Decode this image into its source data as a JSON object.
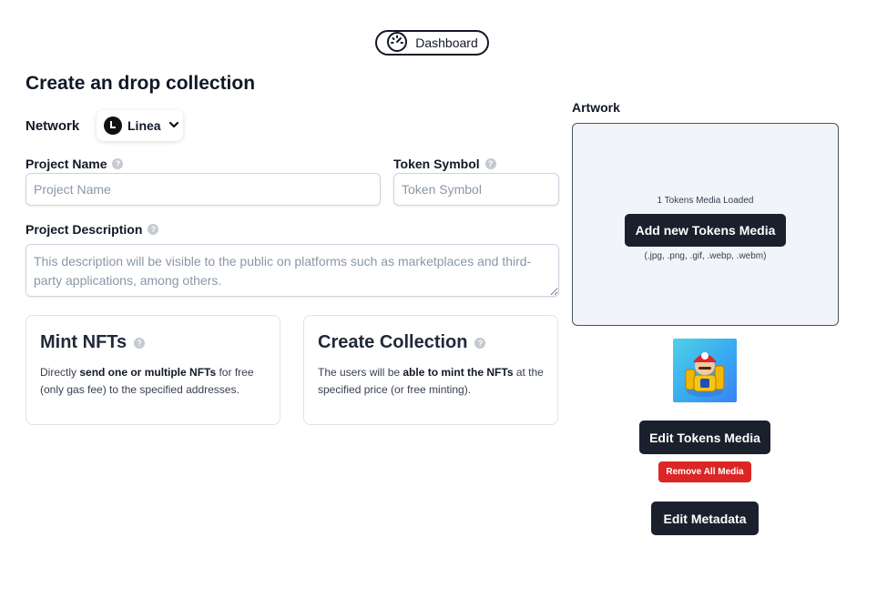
{
  "header": {
    "dashboard_label": "Dashboard"
  },
  "page": {
    "title": "Create an drop collection"
  },
  "network": {
    "label": "Network",
    "selected": "Linea"
  },
  "form": {
    "project_name": {
      "label": "Project Name",
      "placeholder": "Project Name",
      "value": ""
    },
    "token_symbol": {
      "label": "Token Symbol",
      "placeholder": "Token Symbol",
      "value": ""
    },
    "project_description": {
      "label": "Project Description",
      "placeholder": "This description will be visible to the public on platforms such as marketplaces and third-party applications, among others.",
      "value": ""
    }
  },
  "options": {
    "mint": {
      "title": "Mint NFTs",
      "desc_before": "Directly ",
      "desc_bold": "send one or multiple NFTs",
      "desc_after": " for free (only gas fee) to the specified addresses."
    },
    "create": {
      "title": "Create Collection",
      "desc_before": "The users will be ",
      "desc_bold": "able to mint the NFTs",
      "desc_after": " at the specified price (or free minting)."
    }
  },
  "artwork": {
    "label": "Artwork",
    "loaded_text": "1 Tokens Media Loaded",
    "add_button": "Add new Tokens Media",
    "formats": "(.jpg, .png, .gif, .webp, .webm)",
    "edit_media_button": "Edit Tokens Media",
    "remove_all_button": "Remove All Media",
    "edit_metadata_button": "Edit Metadata"
  },
  "colors": {
    "primary_dark": "#1a202c",
    "danger": "#dc2626",
    "dropzone_bg": "#f1f4f9"
  }
}
